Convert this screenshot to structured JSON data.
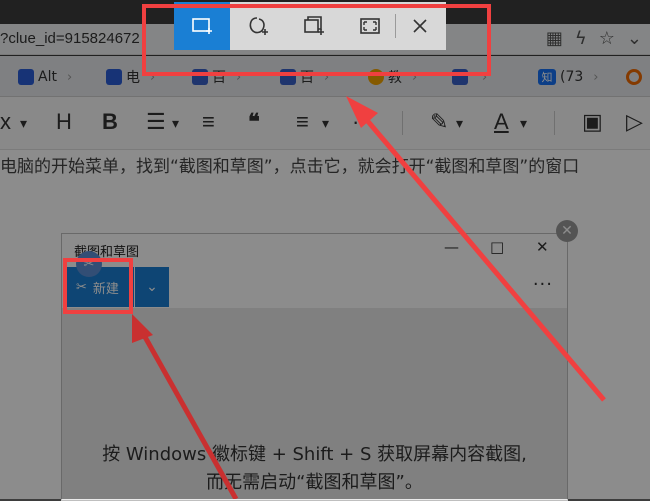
{
  "browser": {
    "url_fragment": "?clue_id=915824672",
    "tabs": [
      {
        "label": "Alt",
        "icon": "baidu-paw-icon"
      },
      {
        "label": "电",
        "icon": "baidu-paw-icon"
      },
      {
        "label": "百",
        "icon": "doc-icon"
      },
      {
        "label": "百",
        "icon": "doc-icon"
      },
      {
        "label": "教",
        "icon": "orange-icon"
      },
      {
        "label": "",
        "icon": "bag-icon"
      },
      {
        "label": "(73",
        "icon": "zhihu-icon",
        "badge": "知"
      },
      {
        "label": "",
        "icon": "orange-ring-icon"
      }
    ]
  },
  "editor": {
    "toolbar": {
      "x_label": "x",
      "heading_label": "H",
      "bold_label": "B"
    },
    "content_line": "电脑的开始菜单，找到“截图和草图”，点击它，就会打开“截图和草图”的窗口"
  },
  "snip_window": {
    "title": "截图和草图",
    "new_label": "新建",
    "hint_line1": "按 Windows 徽标键 + Shift + S 获取屏幕内容截图,",
    "hint_line2": "而无需启动“截图和草图”。"
  },
  "snip_bar": {
    "modes": [
      "rectangle-snip-icon",
      "freeform-snip-icon",
      "window-snip-icon",
      "fullscreen-snip-icon"
    ],
    "close": "close-icon"
  },
  "colors": {
    "accent": "#1a7fd4",
    "annotation_red": "#f04040"
  }
}
